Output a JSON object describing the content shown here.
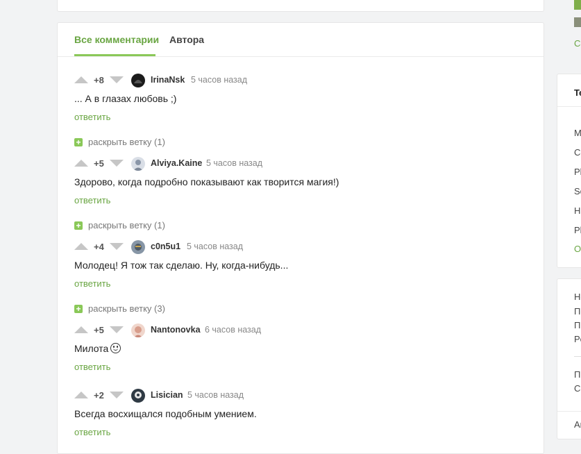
{
  "tabs": [
    {
      "label": "Все комментарии",
      "active": true
    },
    {
      "label": "Автора",
      "active": false
    }
  ],
  "comments": [
    {
      "rating": "+8",
      "author": "IrinaNsk",
      "time": "5 часов назад",
      "text": "... А в глазах любовь ;)",
      "reply": "ответить",
      "avatar_color": "#1b1b1b"
    },
    {
      "rating": "+5",
      "author": "Alviya.Kaine",
      "time": "5 часов назад",
      "text": "Здорово, когда подробно показывают как творится магия!)",
      "reply": "ответить",
      "avatar_color": "#b9c6d6"
    },
    {
      "rating": "+4",
      "author": "c0n5u1",
      "time": "5 часов назад",
      "text": "Молодец! Я тож так сделаю. Ну, когда-нибудь...",
      "reply": "ответить",
      "avatar_color": "#6c7b8c"
    },
    {
      "rating": "+5",
      "author": "Nantonovka",
      "time": "6 часов назад",
      "text": "Милота",
      "reply": "ответить",
      "avatar_color": "#e3b7a8"
    },
    {
      "rating": "+2",
      "author": "Lisician",
      "time": "5 часов назад",
      "text": "Всегда восхищался подобным умением.",
      "reply": "ответить",
      "avatar_color": "#3e4a55"
    }
  ],
  "expanders": [
    {
      "label": "раскрыть ветку (1)"
    },
    {
      "label": "раскрыть ветку (1)"
    },
    {
      "label": "раскрыть ветку (3)"
    }
  ],
  "sidebar": {
    "top_link": "Co",
    "card1_title": "Te",
    "card1_items": [
      "M",
      "Co",
      "Pl",
      "Sc",
      "Ha",
      "Pl",
      "Ot"
    ],
    "card2_items": [
      "He",
      "Пс",
      "Пр",
      "Pe",
      "Пр",
      "Ci",
      "Ar"
    ]
  },
  "colors": {
    "accent": "#69a542",
    "expander": "#8ac858"
  }
}
